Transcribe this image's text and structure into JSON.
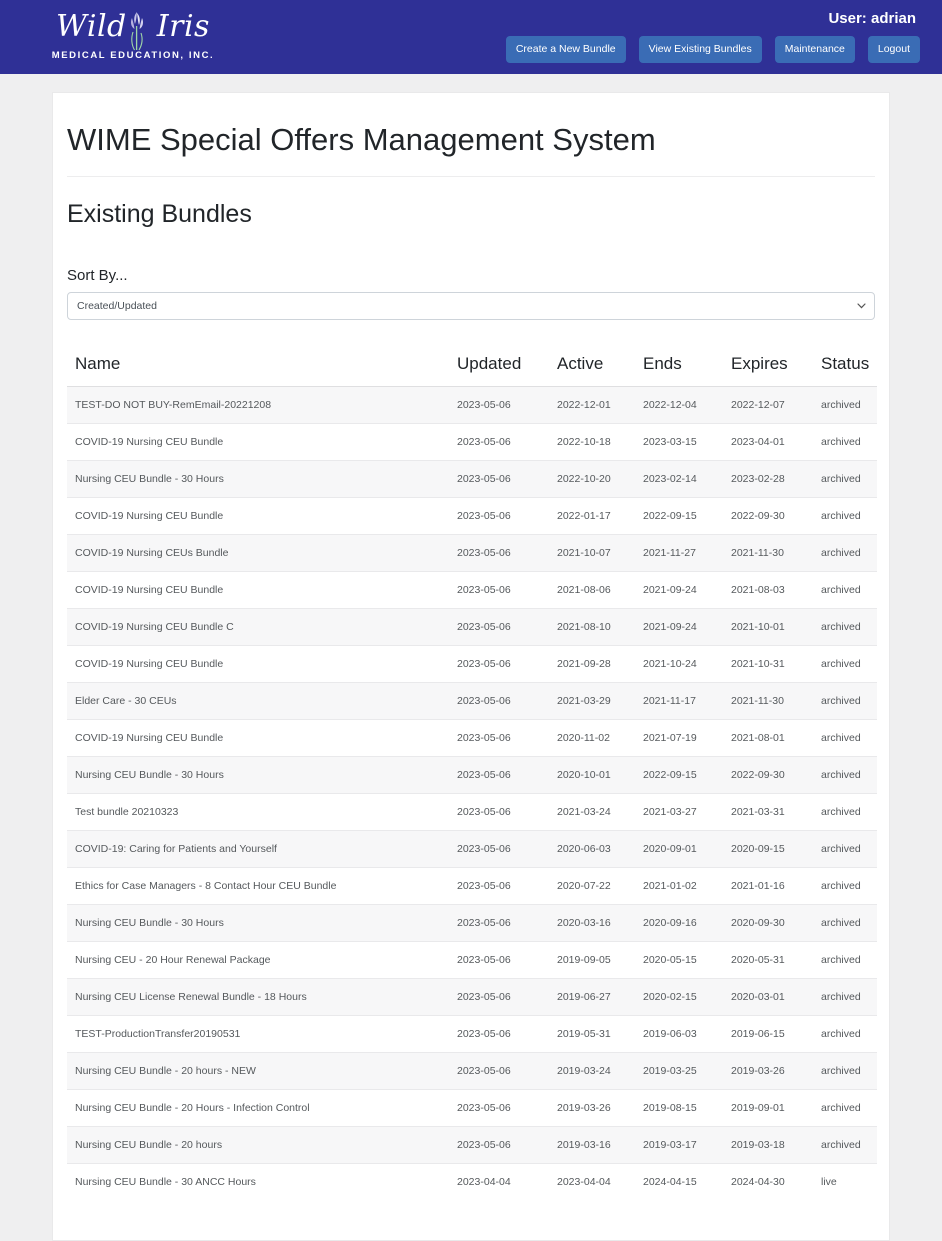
{
  "header": {
    "logo_script_part1": "Wild",
    "logo_script_part2": "Iris",
    "logo_subtitle": "MEDICAL EDUCATION, INC.",
    "user_label": "User: adrian",
    "buttons": [
      {
        "label": "Create a New Bundle",
        "name": "create-new-bundle-button"
      },
      {
        "label": "View Existing Bundles",
        "name": "view-existing-bundles-button"
      },
      {
        "label": "Maintenance",
        "name": "maintenance-button"
      },
      {
        "label": "Logout",
        "name": "logout-button"
      }
    ],
    "colors": {
      "bar_background": "#2f3096",
      "button_background": "#3a6cb5",
      "button_text": "#ffffff"
    }
  },
  "main": {
    "page_title": "WIME Special Offers Management System",
    "section_title": "Existing Bundles",
    "sort": {
      "label": "Sort By...",
      "selected_value": "Created/Updated",
      "icon": "chevron-down-icon"
    },
    "table": {
      "columns": [
        "Name",
        "Updated",
        "Active",
        "Ends",
        "Expires",
        "Status"
      ],
      "rows": [
        {
          "name": "TEST-DO NOT BUY-RemEmail-20221208",
          "updated": "2023-05-06",
          "active": "2022-12-01",
          "ends": "2022-12-04",
          "expires": "2022-12-07",
          "status": "archived"
        },
        {
          "name": "COVID-19 Nursing CEU Bundle",
          "updated": "2023-05-06",
          "active": "2022-10-18",
          "ends": "2023-03-15",
          "expires": "2023-04-01",
          "status": "archived"
        },
        {
          "name": "Nursing CEU Bundle - 30 Hours",
          "updated": "2023-05-06",
          "active": "2022-10-20",
          "ends": "2023-02-14",
          "expires": "2023-02-28",
          "status": "archived"
        },
        {
          "name": "COVID-19 Nursing CEU Bundle",
          "updated": "2023-05-06",
          "active": "2022-01-17",
          "ends": "2022-09-15",
          "expires": "2022-09-30",
          "status": "archived"
        },
        {
          "name": "COVID-19 Nursing CEUs Bundle",
          "updated": "2023-05-06",
          "active": "2021-10-07",
          "ends": "2021-11-27",
          "expires": "2021-11-30",
          "status": "archived"
        },
        {
          "name": "COVID-19 Nursing CEU Bundle",
          "updated": "2023-05-06",
          "active": "2021-08-06",
          "ends": "2021-09-24",
          "expires": "2021-08-03",
          "status": "archived"
        },
        {
          "name": "COVID-19 Nursing CEU Bundle C",
          "updated": "2023-05-06",
          "active": "2021-08-10",
          "ends": "2021-09-24",
          "expires": "2021-10-01",
          "status": "archived"
        },
        {
          "name": "COVID-19 Nursing CEU Bundle",
          "updated": "2023-05-06",
          "active": "2021-09-28",
          "ends": "2021-10-24",
          "expires": "2021-10-31",
          "status": "archived"
        },
        {
          "name": "Elder Care - 30 CEUs",
          "updated": "2023-05-06",
          "active": "2021-03-29",
          "ends": "2021-11-17",
          "expires": "2021-11-30",
          "status": "archived"
        },
        {
          "name": "COVID-19 Nursing CEU Bundle",
          "updated": "2023-05-06",
          "active": "2020-11-02",
          "ends": "2021-07-19",
          "expires": "2021-08-01",
          "status": "archived"
        },
        {
          "name": "Nursing CEU Bundle - 30 Hours",
          "updated": "2023-05-06",
          "active": "2020-10-01",
          "ends": "2022-09-15",
          "expires": "2022-09-30",
          "status": "archived"
        },
        {
          "name": "Test bundle 20210323",
          "updated": "2023-05-06",
          "active": "2021-03-24",
          "ends": "2021-03-27",
          "expires": "2021-03-31",
          "status": "archived"
        },
        {
          "name": "COVID-19: Caring for Patients and Yourself",
          "updated": "2023-05-06",
          "active": "2020-06-03",
          "ends": "2020-09-01",
          "expires": "2020-09-15",
          "status": "archived"
        },
        {
          "name": "Ethics for Case Managers - 8 Contact Hour CEU Bundle",
          "updated": "2023-05-06",
          "active": "2020-07-22",
          "ends": "2021-01-02",
          "expires": "2021-01-16",
          "status": "archived"
        },
        {
          "name": "Nursing CEU Bundle - 30 Hours",
          "updated": "2023-05-06",
          "active": "2020-03-16",
          "ends": "2020-09-16",
          "expires": "2020-09-30",
          "status": "archived"
        },
        {
          "name": "Nursing CEU - 20 Hour Renewal Package",
          "updated": "2023-05-06",
          "active": "2019-09-05",
          "ends": "2020-05-15",
          "expires": "2020-05-31",
          "status": "archived"
        },
        {
          "name": "Nursing CEU License Renewal Bundle - 18 Hours",
          "updated": "2023-05-06",
          "active": "2019-06-27",
          "ends": "2020-02-15",
          "expires": "2020-03-01",
          "status": "archived"
        },
        {
          "name": "TEST-ProductionTransfer20190531",
          "updated": "2023-05-06",
          "active": "2019-05-31",
          "ends": "2019-06-03",
          "expires": "2019-06-15",
          "status": "archived"
        },
        {
          "name": "Nursing CEU Bundle - 20 hours - NEW",
          "updated": "2023-05-06",
          "active": "2019-03-24",
          "ends": "2019-03-25",
          "expires": "2019-03-26",
          "status": "archived"
        },
        {
          "name": "Nursing CEU Bundle - 20 Hours - Infection Control",
          "updated": "2023-05-06",
          "active": "2019-03-26",
          "ends": "2019-08-15",
          "expires": "2019-09-01",
          "status": "archived"
        },
        {
          "name": "Nursing CEU Bundle - 20 hours",
          "updated": "2023-05-06",
          "active": "2019-03-16",
          "ends": "2019-03-17",
          "expires": "2019-03-18",
          "status": "archived"
        },
        {
          "name": "Nursing CEU Bundle - 30 ANCC Hours",
          "updated": "2023-04-04",
          "active": "2023-04-04",
          "ends": "2024-04-15",
          "expires": "2024-04-30",
          "status": "live"
        }
      ]
    }
  }
}
